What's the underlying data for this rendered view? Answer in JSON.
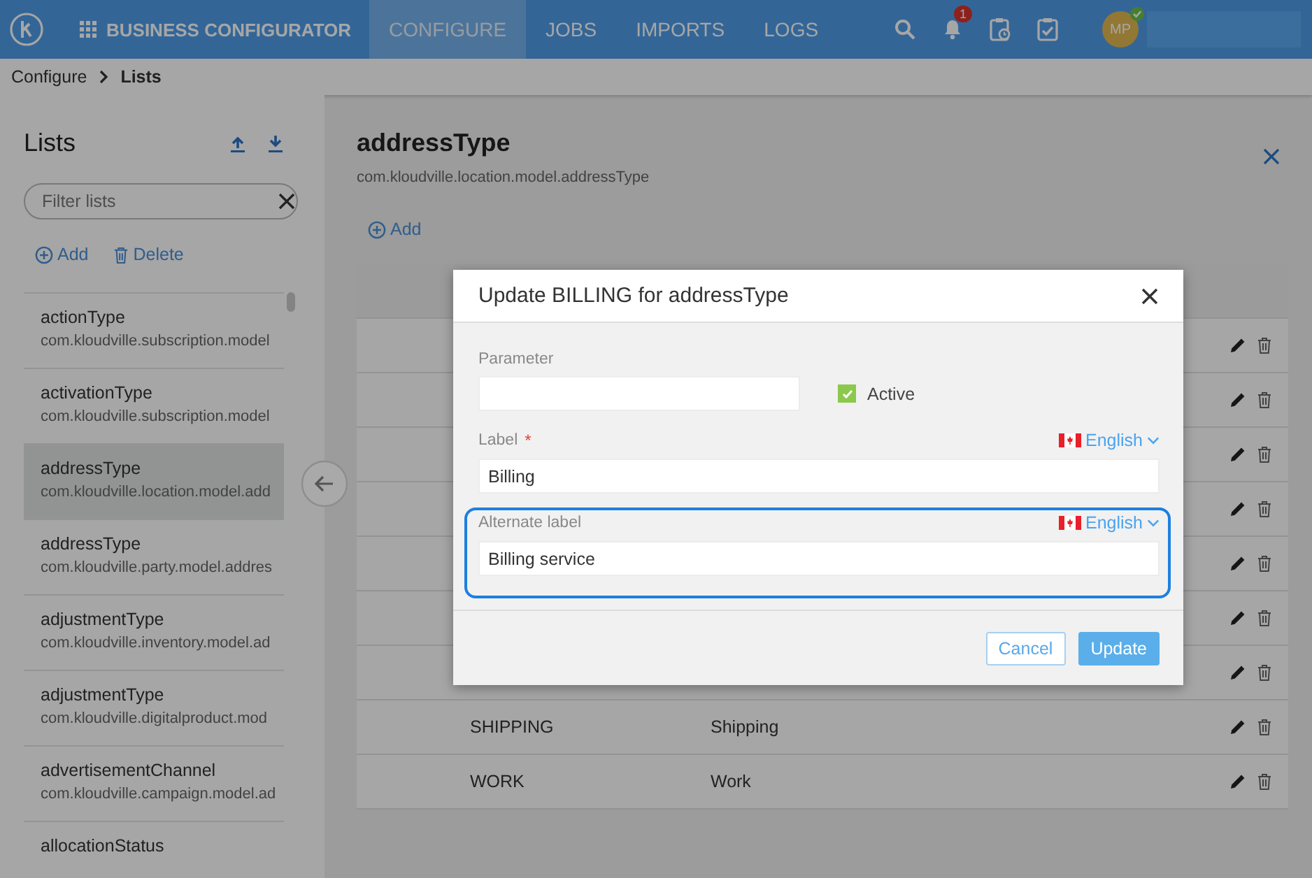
{
  "topbar": {
    "app_title": "BUSINESS CONFIGURATOR",
    "nav": [
      {
        "label": "CONFIGURE",
        "selected": true
      },
      {
        "label": "JOBS",
        "selected": false
      },
      {
        "label": "IMPORTS",
        "selected": false
      },
      {
        "label": "LOGS",
        "selected": false
      }
    ],
    "notification_count": "1",
    "avatar": "MP"
  },
  "breadcrumb": [
    "Configure",
    "Lists"
  ],
  "sidebar": {
    "title": "Lists",
    "filter": {
      "placeholder": "Filter lists"
    },
    "actions": [
      "Add",
      "Delete"
    ],
    "items": [
      {
        "name": "actionType",
        "path": "com.kloudville.subscription.model",
        "selected": false
      },
      {
        "name": "activationType",
        "path": "com.kloudville.subscription.model",
        "selected": false
      },
      {
        "name": "addressType",
        "path": "com.kloudville.location.model.add",
        "selected": true
      },
      {
        "name": "addressType",
        "path": "com.kloudville.party.model.addres",
        "selected": false
      },
      {
        "name": "adjustmentType",
        "path": "com.kloudville.inventory.model.ad",
        "selected": false
      },
      {
        "name": "adjustmentType",
        "path": "com.kloudville.digitalproduct.mod",
        "selected": false
      },
      {
        "name": "advertisementChannel",
        "path": "com.kloudville.campaign.model.ad",
        "selected": false
      },
      {
        "name": "allocationStatus",
        "selected": false
      }
    ]
  },
  "detail": {
    "title": "addressType",
    "subtitle": "com.kloudville.location.model.addressType",
    "add": "Add",
    "rows": [
      {
        "editable": true
      },
      {
        "editable": true
      },
      {
        "editable": true
      },
      {
        "editable": true
      },
      {
        "editable": true
      },
      {
        "editable": true
      },
      {
        "editable": true
      },
      {
        "editable": true,
        "code": "SHIPPING",
        "label": "Shipping"
      },
      {
        "editable": true,
        "code": "WORK",
        "label": "Work"
      }
    ]
  },
  "dialog": {
    "title": "Update BILLING for addressType",
    "parameter": {
      "label": "Parameter"
    },
    "active": {
      "label": "Active",
      "checked": true
    },
    "fields": [
      {
        "label": "Label",
        "required_mark": "*",
        "language": "English",
        "value": "Billing",
        "focused": false
      },
      {
        "label": "Alternate label",
        "language": "English",
        "value": "Billing service",
        "focused": true
      }
    ],
    "buttons": [
      {
        "label": "Cancel",
        "kind": "secondary"
      },
      {
        "label": "Update",
        "kind": "primary"
      }
    ]
  }
}
